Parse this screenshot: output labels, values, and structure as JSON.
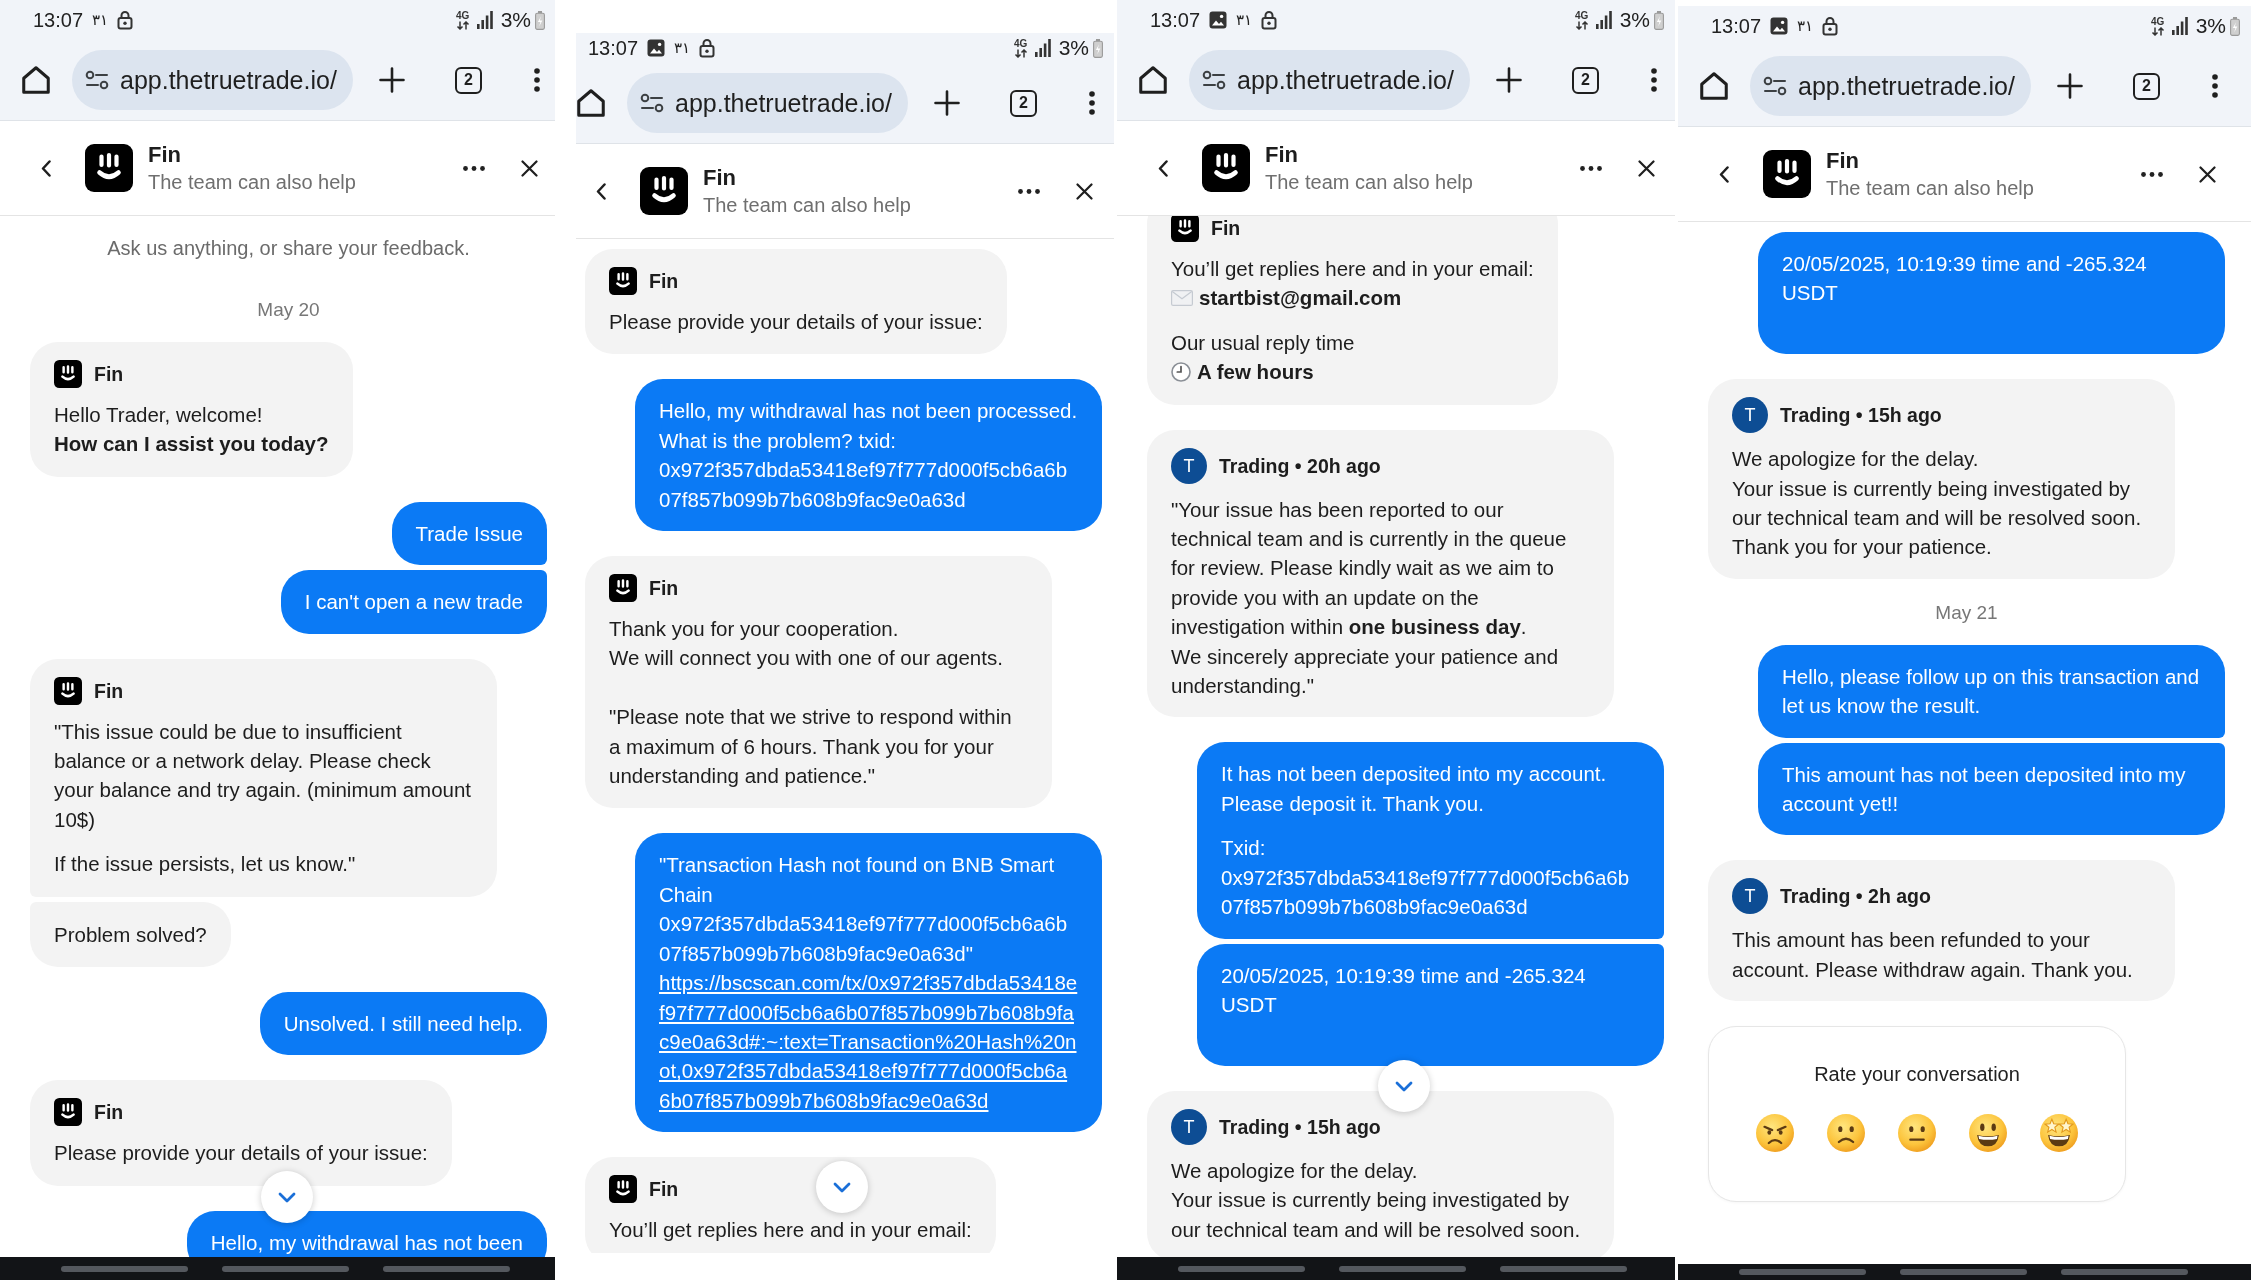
{
  "panels": [
    {
      "status_bar": {
        "time": "13:07",
        "image_notification": false,
        "calendar_badge": "۳۱",
        "network": "4G",
        "battery": "3%"
      },
      "browser": {
        "url": "app.thetruetrade.io/",
        "tab_count": "2"
      },
      "header": {
        "title": "Fin",
        "subtitle": "The team can also help"
      },
      "messages": [
        {
          "kind": "notice",
          "text": "Ask us anything, or share your feedback."
        },
        {
          "kind": "date",
          "text": "May 20"
        },
        {
          "kind": "bot",
          "sender": "Fin",
          "paragraphs": [
            {
              "kind": "text",
              "text": "Hello Trader, welcome!\n**How can I assist you today?**"
            }
          ]
        },
        {
          "kind": "user",
          "paragraphs": [
            {
              "kind": "text",
              "text": "Trade Issue"
            }
          ]
        },
        {
          "kind": "user",
          "paragraphs": [
            {
              "kind": "text",
              "text": "I can't open a new trade"
            }
          ]
        },
        {
          "kind": "bot",
          "sender": "Fin",
          "paragraphs": [
            {
              "kind": "text",
              "text": "\"This issue could be due to insufficient balance or a network delay. Please check your balance and try again. (minimum amount 10$)"
            },
            {
              "kind": "text",
              "text": "If the issue persists, let us know.\""
            }
          ]
        },
        {
          "kind": "bot",
          "paragraphs": [
            {
              "kind": "text",
              "text": "Problem solved?"
            }
          ]
        },
        {
          "kind": "user",
          "paragraphs": [
            {
              "kind": "text",
              "text": "Unsolved. I still need help."
            }
          ]
        },
        {
          "kind": "bot",
          "sender": "Fin",
          "paragraphs": [
            {
              "kind": "text",
              "text": "Please provide your details of your issue:"
            }
          ]
        },
        {
          "kind": "user",
          "paragraphs": [
            {
              "kind": "text",
              "text": "Hello, my withdrawal has not been"
            }
          ]
        }
      ],
      "scroll_down_button": true,
      "navigation_bar": true
    },
    {
      "status_bar": {
        "time": "13:07",
        "image_notification": true,
        "calendar_badge": "۳۱",
        "network": "4G",
        "battery": "3%"
      },
      "browser": {
        "url": "app.thetruetrade.io/",
        "tab_count": "2"
      },
      "header": {
        "title": "Fin",
        "subtitle": "The team can also help"
      },
      "messages": [
        {
          "kind": "bot",
          "sender": "Fin",
          "paragraphs": [
            {
              "kind": "text",
              "text": "Please provide your details of your issue:"
            }
          ]
        },
        {
          "kind": "user",
          "paragraphs": [
            {
              "kind": "text",
              "text": "Hello, my withdrawal has not been processed. What is the problem? txid: 0x972f357dbda53418ef97f777d000f5cb6a6b07f857b099b7b608b9fac9e0a63d"
            }
          ]
        },
        {
          "kind": "bot",
          "sender": "Fin",
          "paragraphs": [
            {
              "kind": "text",
              "text": "Thank you for your cooperation.\nWe will connect you with one of our agents.\n\n\"Please note that we strive to respond within a maximum of 6 hours. Thank you for your understanding and patience.\""
            }
          ]
        },
        {
          "kind": "user",
          "paragraphs": [
            {
              "kind": "text",
              "text": "\"Transaction Hash not found on BNB Smart Chain 0x972f357dbda53418ef97f777d000f5cb6a6b07f857b099b7b608b9fac9e0a63d\""
            },
            {
              "kind": "link",
              "text": "https://bscscan.com/tx/0x972f357dbda53418ef97f777d000f5cb6a6b07f857b099b7b608b9fac9e0a63d#:~:text=Transaction%20Hash%20not,0x972f357dbda53418ef97f777d000f5cb6a6b07f857b099b7b608b9fac9e0a63d"
            }
          ]
        },
        {
          "kind": "bot",
          "sender": "Fin",
          "paragraphs": [
            {
              "kind": "text",
              "text": "You’ll get replies here and in your email:"
            }
          ]
        }
      ],
      "scroll_down_button": true,
      "navigation_bar": false
    },
    {
      "status_bar": {
        "time": "13:07",
        "image_notification": true,
        "calendar_badge": "۳۱",
        "network": "4G",
        "battery": "3%"
      },
      "browser": {
        "url": "app.thetruetrade.io/",
        "tab_count": "2"
      },
      "header": {
        "title": "Fin",
        "subtitle": "The team can also help"
      },
      "messages": [
        {
          "kind": "bot",
          "sender": "Fin",
          "continues_above": true,
          "paragraphs": [
            {
              "kind": "email",
              "label": "You’ll get replies here and in your email:",
              "value": "startbist@gmail.com"
            },
            {
              "kind": "reply_time",
              "label": "Our usual reply time",
              "value": "A few hours"
            }
          ]
        },
        {
          "kind": "agent",
          "avatar": "T",
          "header": "Trading • 20h ago",
          "paragraphs": [
            {
              "kind": "text",
              "text": "\"Your issue has been reported to our technical team and is currently in the queue for review. Please kindly wait as we aim to provide you with an update on the investigation within **one business day**.\nWe sincerely appreciate your patience and understanding.\""
            }
          ]
        },
        {
          "kind": "user",
          "paragraphs": [
            {
              "kind": "text",
              "text": "It has not been deposited into my account. Please deposit it. Thank you."
            },
            {
              "kind": "text",
              "text": "Txid: 0x972f357dbda53418ef97f777d000f5cb6a6b07f857b099b7b608b9fac9e0a63d"
            }
          ]
        },
        {
          "kind": "user",
          "ends_with_blank_line": true,
          "paragraphs": [
            {
              "kind": "text",
              "text": "20/05/2025, 10:19:39 time and -265.324 USDT"
            }
          ]
        },
        {
          "kind": "agent",
          "avatar": "T",
          "header": "Trading • 15h ago",
          "paragraphs": [
            {
              "kind": "text",
              "text": "We apologize for the delay.\nYour issue is currently being investigated by our technical team and will be resolved soon."
            }
          ]
        }
      ],
      "scroll_down_button": true,
      "navigation_bar": true
    },
    {
      "status_bar": {
        "time": "13:07",
        "image_notification": true,
        "calendar_badge": "۳۱",
        "network": "4G",
        "battery": "3%"
      },
      "browser": {
        "url": "app.thetruetrade.io/",
        "tab_count": "2"
      },
      "header": {
        "title": "Fin",
        "subtitle": "The team can also help"
      },
      "messages": [
        {
          "kind": "user",
          "ends_with_blank_line": true,
          "paragraphs": [
            {
              "kind": "text",
              "text": "20/05/2025, 10:19:39 time and -265.324 USDT"
            }
          ]
        },
        {
          "kind": "agent",
          "avatar": "T",
          "header": "Trading • 15h ago",
          "paragraphs": [
            {
              "kind": "text",
              "text": "We apologize for the delay.\nYour issue is currently being investigated by our technical team and will be resolved soon.\nThank you for your patience."
            }
          ]
        },
        {
          "kind": "date",
          "text": "May 21"
        },
        {
          "kind": "user",
          "paragraphs": [
            {
              "kind": "text",
              "text": "Hello, please follow up on this transaction and let us know the result."
            }
          ]
        },
        {
          "kind": "user",
          "paragraphs": [
            {
              "kind": "text",
              "text": "This amount has not been deposited into my account yet!!"
            }
          ]
        },
        {
          "kind": "agent",
          "avatar": "T",
          "header": "Trading • 2h ago",
          "paragraphs": [
            {
              "kind": "text",
              "text": "This amount has been refunded to your account. Please withdraw again. Thank you."
            }
          ]
        },
        {
          "kind": "rating",
          "prompt": "Rate your conversation",
          "options": [
            {
              "kind": "angry",
              "selected": false
            },
            {
              "kind": "sad",
              "selected": false
            },
            {
              "kind": "neutral",
              "selected": false
            },
            {
              "kind": "happy",
              "selected": false
            },
            {
              "kind": "amazed",
              "selected": false
            }
          ]
        }
      ],
      "scroll_down_button": false,
      "navigation_bar": true
    }
  ]
}
